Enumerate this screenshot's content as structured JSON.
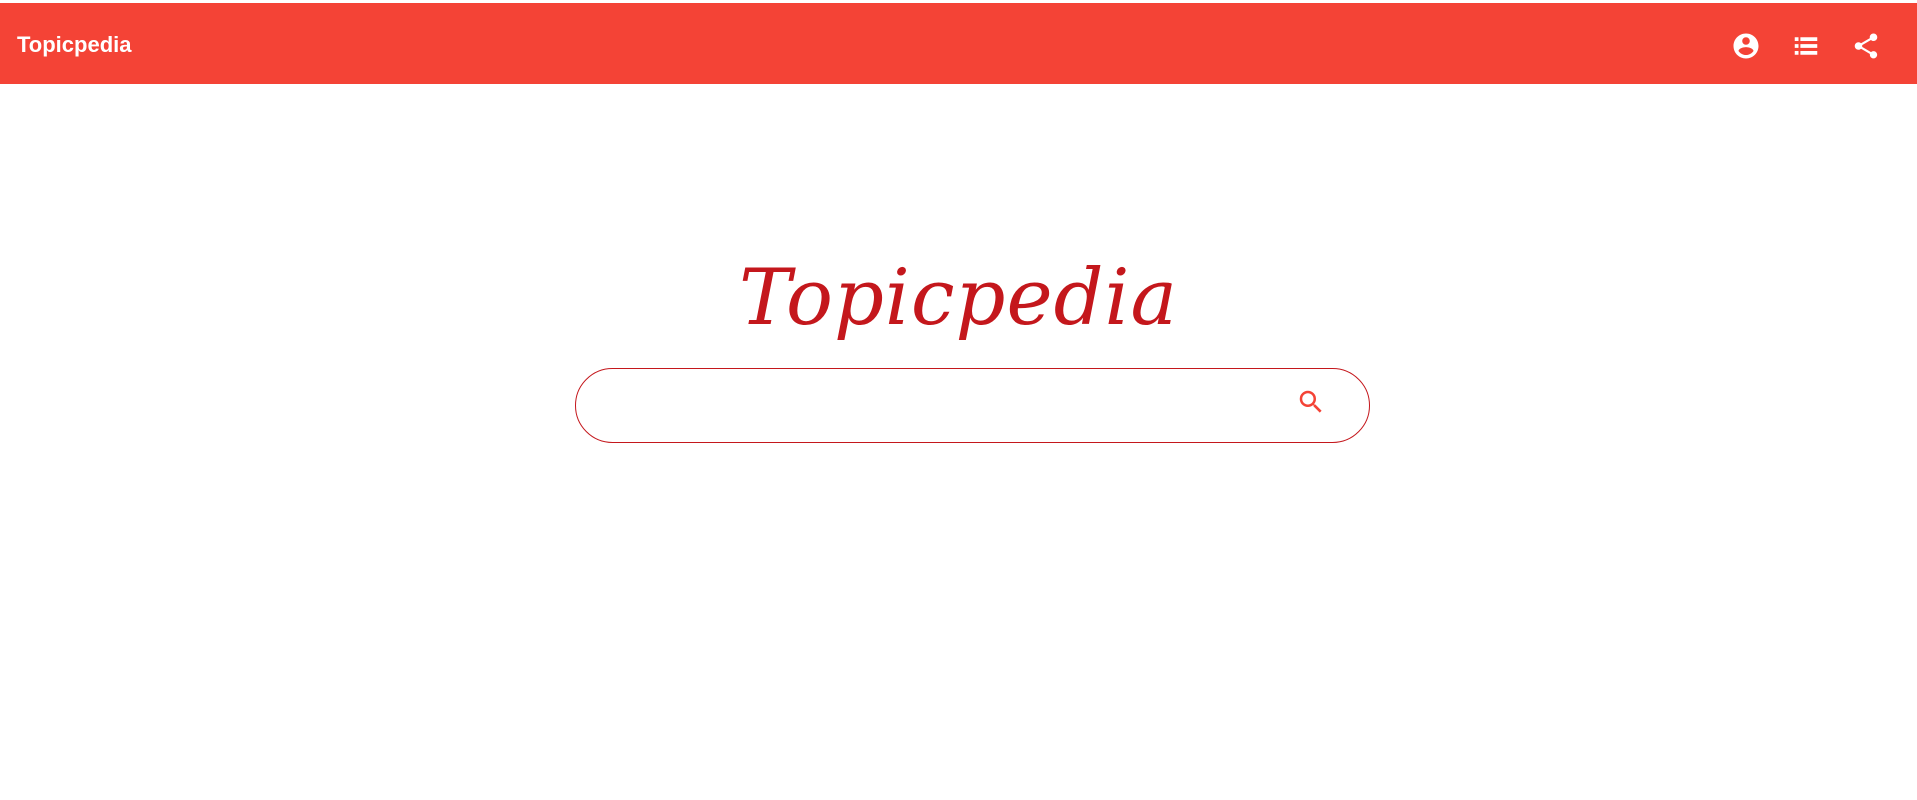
{
  "appbar": {
    "title": "Topicpedia",
    "background": "#f44336",
    "actions": [
      {
        "icon": "account-circle-icon"
      },
      {
        "icon": "list-icon"
      },
      {
        "icon": "share-icon"
      }
    ]
  },
  "main": {
    "brand": "Topicpedia",
    "brand_color": "#c4171c",
    "search": {
      "value": "",
      "placeholder": "",
      "button_icon": "search-icon"
    }
  }
}
